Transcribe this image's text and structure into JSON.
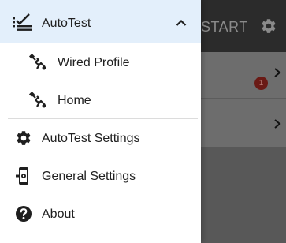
{
  "background": {
    "start_label": "START",
    "gear_icon": "gear-icon",
    "badge_count": "1"
  },
  "drawer": {
    "autotest": {
      "label": "AutoTest",
      "icon": "autotest-checklist-icon",
      "expand_icon": "chevron-up-icon"
    },
    "profiles": [
      {
        "label": "Wired Profile",
        "icon": "ethernet-cable-icon"
      },
      {
        "label": "Home",
        "icon": "ethernet-cable-icon"
      }
    ],
    "autotest_settings": {
      "label": "AutoTest Settings",
      "icon": "gear-icon"
    },
    "general_settings": {
      "label": "General Settings",
      "icon": "device-settings-icon"
    },
    "about": {
      "label": "About",
      "icon": "help-circle-icon"
    }
  },
  "colors": {
    "selected_row": "#e3effb",
    "icon": "#1f1f1f",
    "text": "#212121",
    "scrim_bg": "#585858"
  }
}
